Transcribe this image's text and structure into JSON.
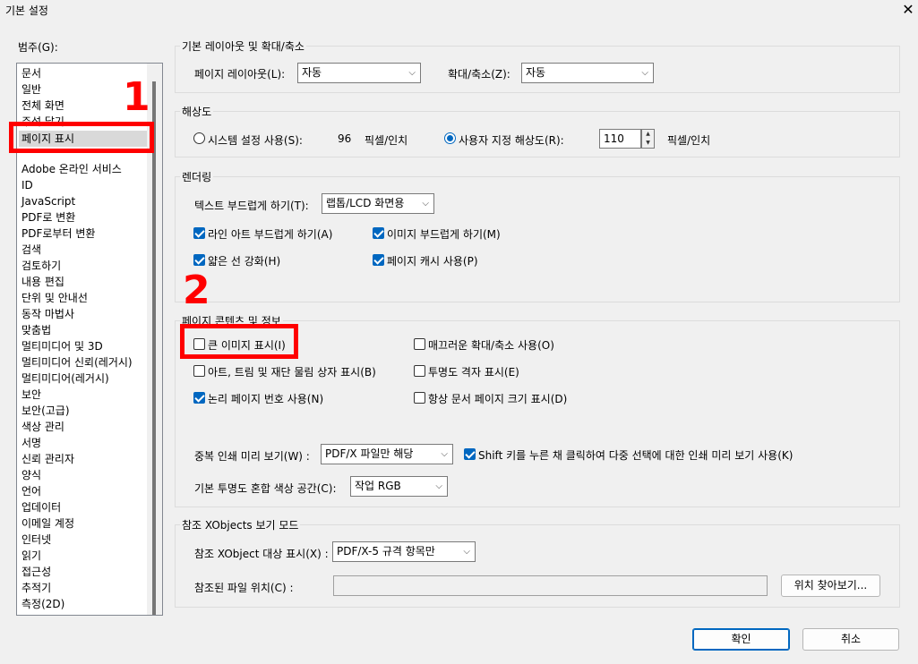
{
  "window": {
    "title": "기본 설정",
    "close_glyph": "✕"
  },
  "categories": {
    "label": "범주(G):",
    "items": [
      "문서",
      "일반",
      "전체 화면",
      "주석 달기",
      "페이지 표시",
      "Adobe 온라인 서비스",
      "ID",
      "JavaScript",
      "PDF로 변환",
      "PDF로부터 변환",
      "검색",
      "검토하기",
      "내용 편집",
      "단위 및 안내선",
      "동작 마법사",
      "맞춤법",
      "멀티미디어 및 3D",
      "멀티미디어 신뢰(레거시)",
      "멀티미디어(레거시)",
      "보안",
      "보안(고급)",
      "색상 관리",
      "서명",
      "신뢰 관리자",
      "양식",
      "언어",
      "업데이터",
      "이메일 계정",
      "인터넷",
      "읽기",
      "접근성",
      "추적기",
      "측정(2D)"
    ],
    "selected": "페이지 표시"
  },
  "layout_zoom": {
    "title": "기본 레이아웃 및 확대/축소",
    "page_layout_label": "페이지 레이아웃(L):",
    "page_layout_value": "자동",
    "zoom_label": "확대/축소(Z):",
    "zoom_value": "자동"
  },
  "resolution": {
    "title": "해상도",
    "system_label": "시스템 설정 사용(S):",
    "system_value": "96",
    "system_unit": "픽셀/인치",
    "custom_label": "사용자 지정 해상도(R):",
    "custom_value": "110",
    "custom_unit": "픽셀/인치"
  },
  "rendering": {
    "title": "렌더링",
    "smooth_text_label": "텍스트 부드럽게 하기(T):",
    "smooth_text_value": "랩톱/LCD 화면용",
    "smooth_line_art": "라인 아트 부드럽게 하기(A)",
    "smooth_images": "이미지 부드럽게 하기(M)",
    "thin_lines": "얇은 선 강화(H)",
    "page_cache": "페이지 캐시 사용(P)"
  },
  "page_content": {
    "title": "페이지 콘텐츠 및 정보",
    "large_images": "큰 이미지 표시(I)",
    "smooth_zoom": "매끄러운 확대/축소 사용(O)",
    "art_trim_bleed": "아트, 트림 및 재단 물림 상자 표시(B)",
    "transparency_grid": "투명도 격자 표시(E)",
    "logical_page_numbers": "논리 페이지 번호 사용(N)",
    "always_doc_page_size": "항상 문서 페이지 크기 표시(D)",
    "overprint_label": "중복 인쇄 미리 보기(W) :",
    "overprint_value": "PDF/X 파일만 해당",
    "shift_key": "Shift 키를 누른 채 클릭하여 다중 선택에 대한 인쇄 미리 보기 사용(K)",
    "blend_space_label": "기본 투명도 혼합 색상 공간(C):",
    "blend_space_value": "작업 RGB"
  },
  "xobjects": {
    "title": "참조 XObjects 보기 모드",
    "target_label": "참조 XObject 대상 표시(X) :",
    "target_value": "PDF/X-5 규격 항목만",
    "file_location_label": "참조된 파일 위치(C) :",
    "file_location_value": "",
    "browse_button": "위치 찾아보기..."
  },
  "footer": {
    "ok": "확인",
    "cancel": "취소"
  },
  "annotations": {
    "num1": "1",
    "num2": "2"
  },
  "checkbox_states": {
    "smooth_line_art": true,
    "smooth_images": true,
    "thin_lines": true,
    "page_cache": true,
    "large_images": false,
    "smooth_zoom": false,
    "art_trim_bleed": false,
    "transparency_grid": false,
    "logical_page_numbers": true,
    "always_doc_page_size": false,
    "shift_key": true
  },
  "colors": {
    "accent": "#0067c0",
    "highlight_red": "#ff0000"
  }
}
